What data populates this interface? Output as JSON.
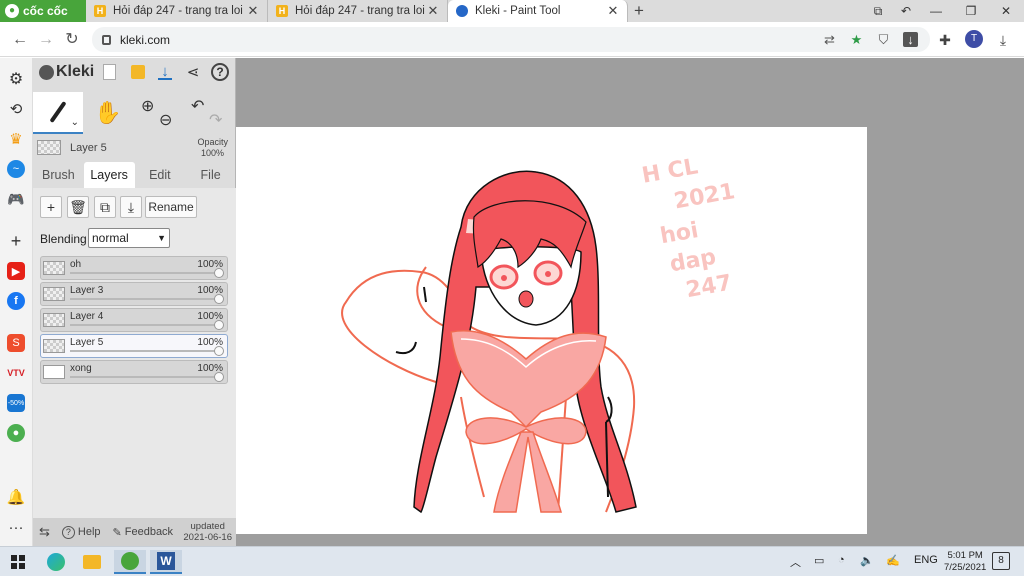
{
  "browser": {
    "brand": "cốc cốc",
    "tabs": [
      {
        "label": "Hỏi đáp 247 - trang tra loi",
        "icon": "hoidap-favicon"
      },
      {
        "label": "Hỏi đáp 247 - trang tra loi",
        "icon": "hoidap-favicon"
      },
      {
        "label": "Kleki - Paint Tool",
        "icon": "kleki-favicon"
      }
    ],
    "new_tab": "+",
    "url": "kleki.com",
    "avatar_letter": "T"
  },
  "kleki": {
    "logo": "Kleki",
    "current_layer": "Layer 5",
    "opacity_label": "Opacity",
    "opacity_value": "100%",
    "tabs": [
      "Brush",
      "Layers",
      "Edit",
      "File"
    ],
    "active_tab": "Layers",
    "rename_label": "Rename",
    "blending_label": "Blending",
    "blending_value": "normal",
    "layers": [
      {
        "name": "oh",
        "opacity": "100%",
        "selected": false
      },
      {
        "name": "Layer 3",
        "opacity": "100%",
        "selected": false
      },
      {
        "name": "Layer 4",
        "opacity": "100%",
        "selected": false
      },
      {
        "name": "Layer 5",
        "opacity": "100%",
        "selected": true
      },
      {
        "name": "xong",
        "opacity": "100%",
        "selected": false
      }
    ],
    "footer": {
      "help": "Help",
      "feedback": "Feedback",
      "updated_label": "updated",
      "updated_date": "2021-06-16"
    }
  },
  "canvas": {
    "watermark_lines": [
      "H CL",
      "2021",
      "hoi",
      "dap",
      "247"
    ],
    "colors": {
      "hair": "#f2555b",
      "hair_light": "#fdd7d4",
      "outline": "#111111",
      "sketch": "#f06a50",
      "bow": "#f9a7a3",
      "watermark": "#f9c4c0"
    }
  },
  "taskbar": {
    "lang": "ENG",
    "time": "5:01 PM",
    "date": "7/25/2021",
    "notifications": "8"
  }
}
